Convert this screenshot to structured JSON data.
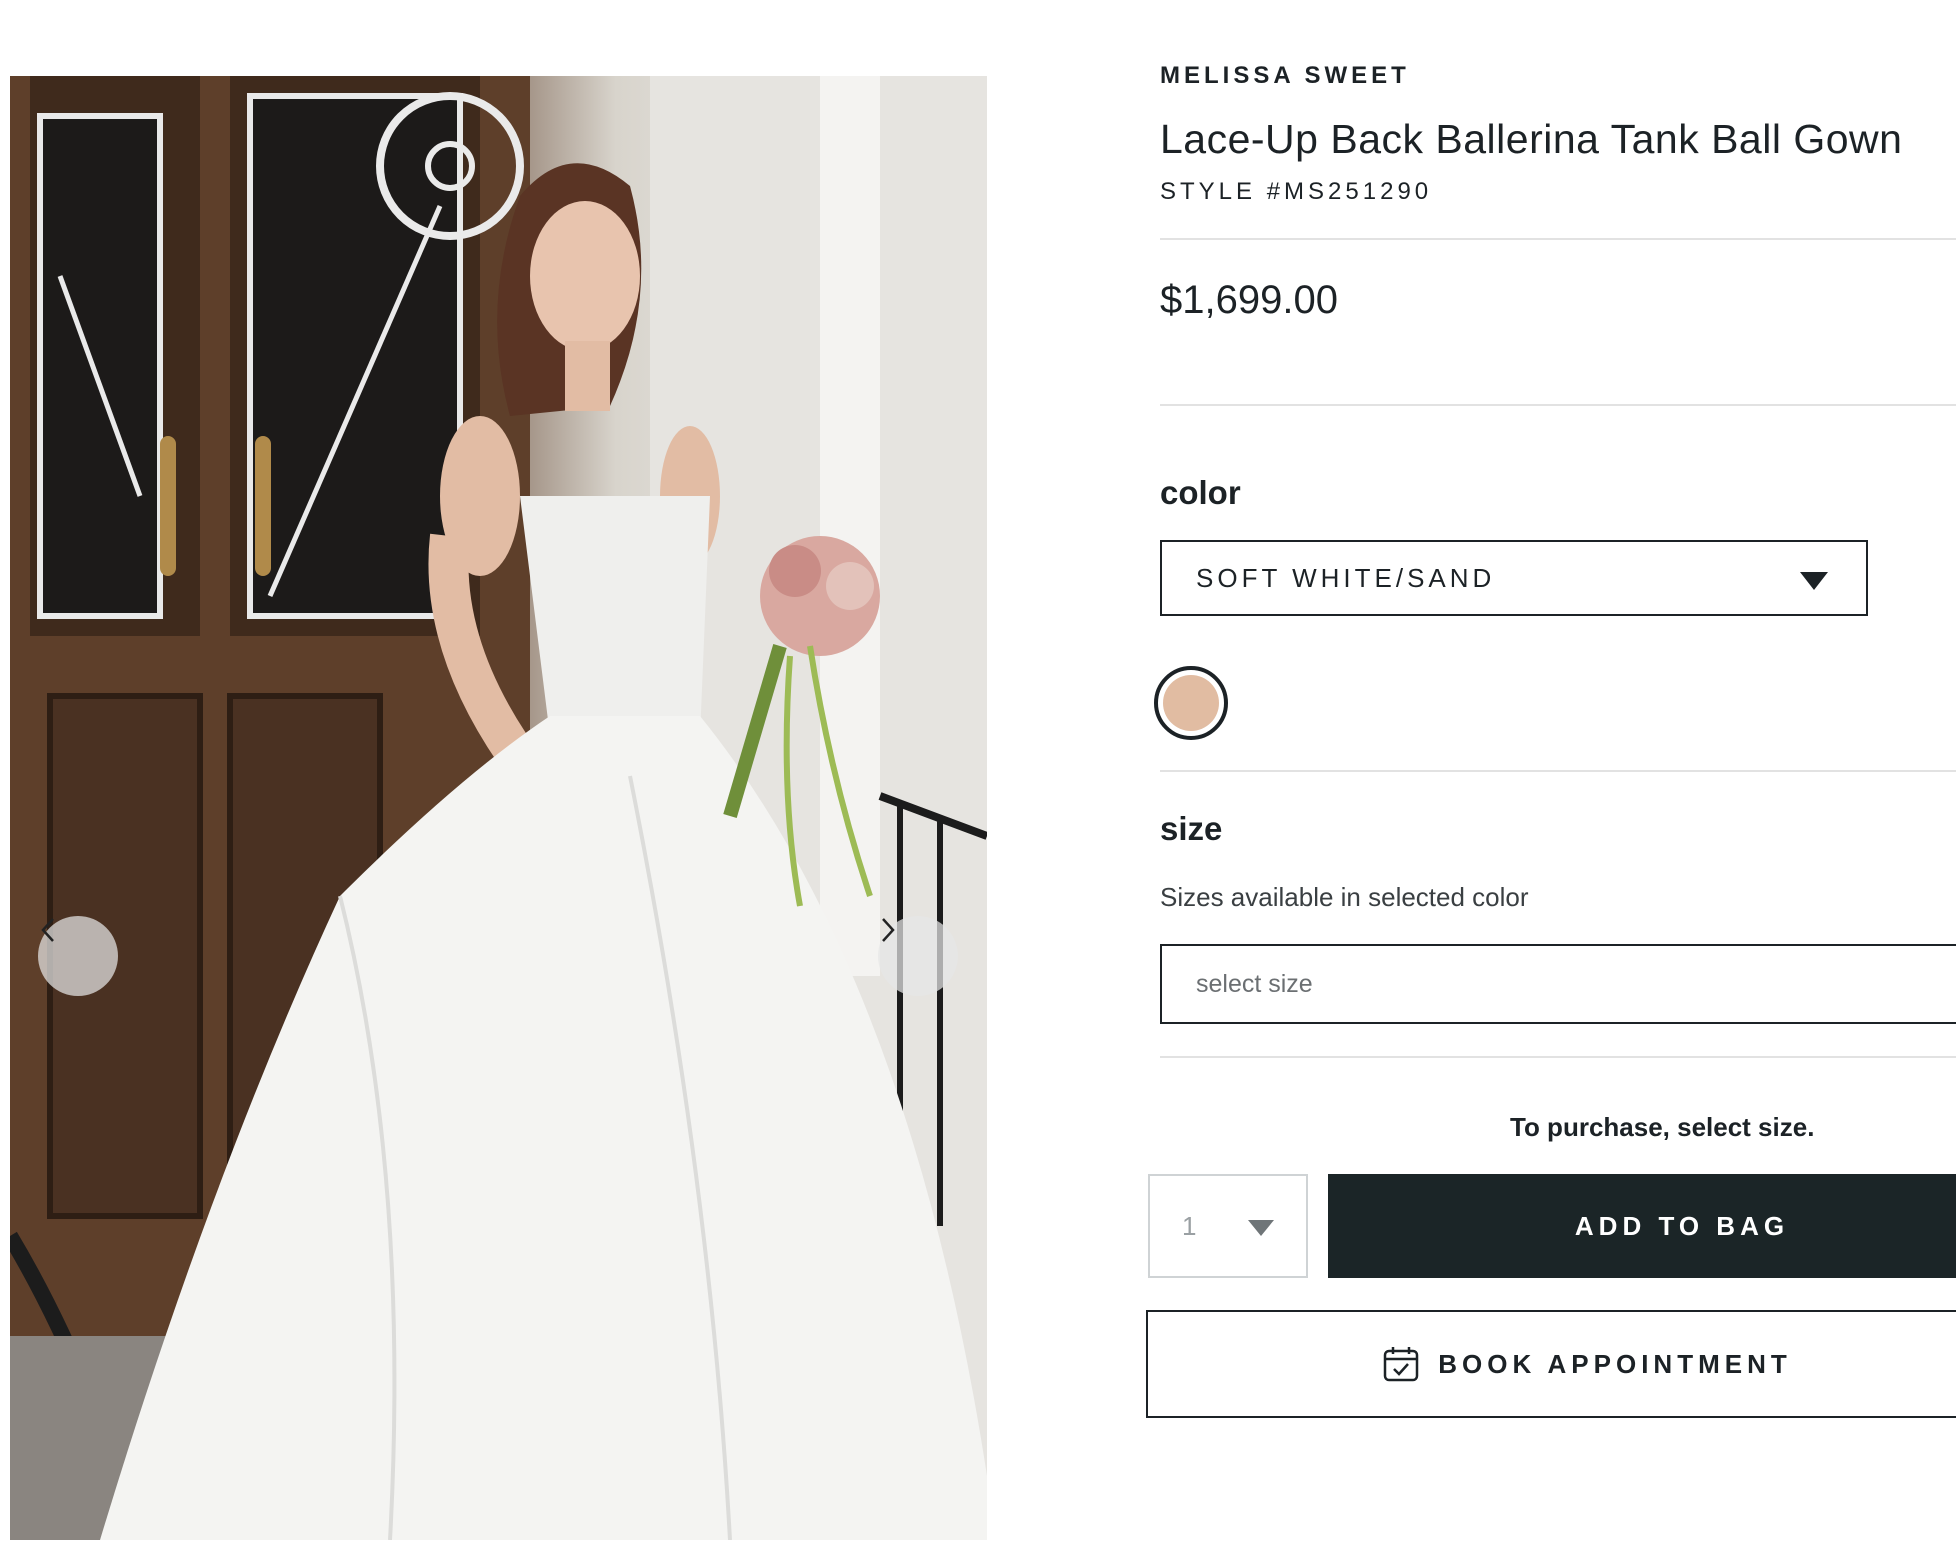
{
  "gallery": {
    "image_alt": "Bride in white ball gown holding bouquet in front of wooden doors",
    "prev_icon": "chevron-left-icon",
    "next_icon": "chevron-right-icon"
  },
  "product": {
    "brand": "MELISSA SWEET",
    "title": "Lace-Up Back Ballerina Tank Ball Gown",
    "style_number": "STYLE #MS251290",
    "price": "$1,699.00"
  },
  "color": {
    "label": "color",
    "selected": "SOFT WHITE/SAND",
    "swatch_hex": "#e1bca2"
  },
  "size": {
    "label": "size",
    "helper": "Sizes available in selected color",
    "placeholder": "select size"
  },
  "purchase": {
    "note": "To purchase, select size.",
    "quantity": "1",
    "add_to_bag": "ADD TO BAG",
    "book_appointment": "BOOK APPOINTMENT",
    "book_icon": "calendar-check-icon"
  },
  "colors": {
    "primary_dark": "#1b2527",
    "text": "#1c2226",
    "divider": "#e2e2e2"
  }
}
